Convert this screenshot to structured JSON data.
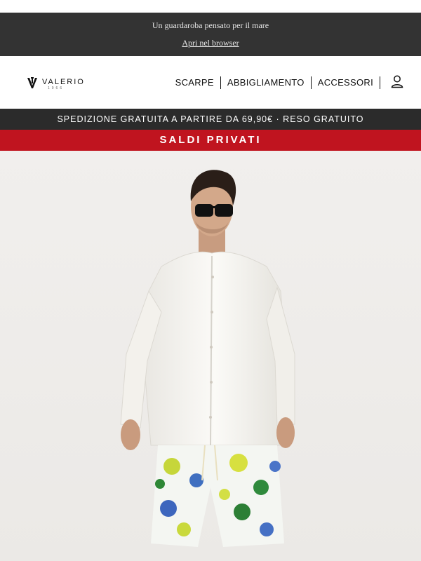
{
  "preheader": {
    "tagline": "Un guardaroba pensato per il mare",
    "browser_link": "Apri nel browser"
  },
  "brand": {
    "logo_text": "VALERIO",
    "logo_year": "1966"
  },
  "nav": {
    "items": [
      {
        "label": "SCARPE"
      },
      {
        "label": "ABBIGLIAMENTO"
      },
      {
        "label": "ACCESSORI"
      }
    ]
  },
  "shipping_banner": {
    "text": "SPEDIZIONE GRATUITA A PARTIRE DA 69,90€ · RESO GRATUITO"
  },
  "sale_banner": {
    "text": "SALDI PRIVATI"
  },
  "colors": {
    "preheader_bg": "#333333",
    "shipping_bg": "#2b2b2b",
    "sale_bg": "#c0141f",
    "text_dark": "#111111"
  },
  "icons": {
    "logo": "valerio-monogram-icon",
    "account": "user-icon"
  }
}
